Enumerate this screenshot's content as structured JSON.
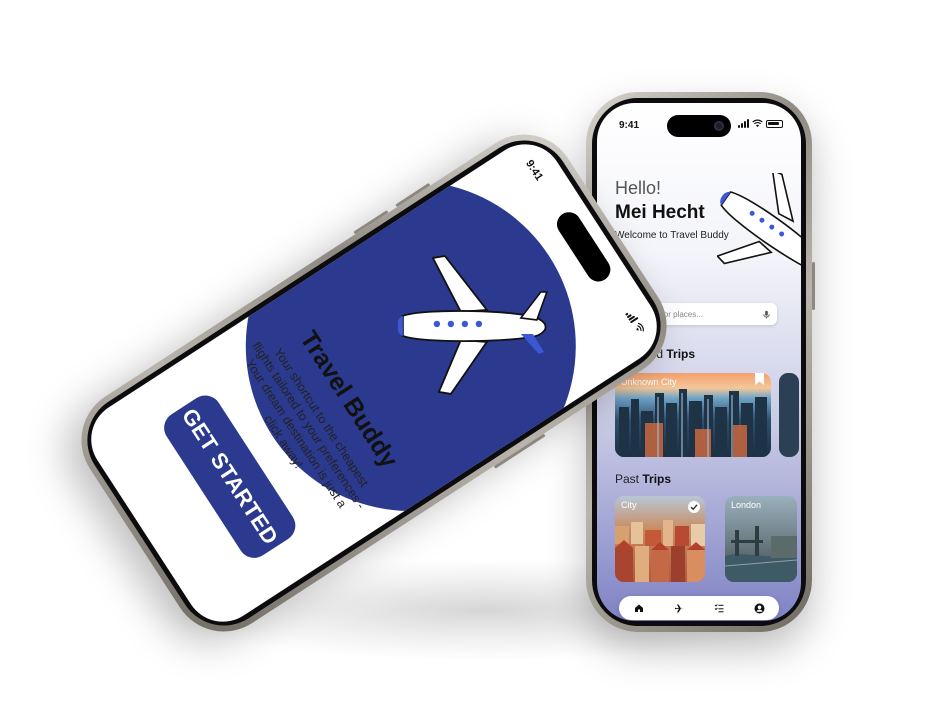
{
  "right_phone": {
    "status_time": "9:41",
    "hello": "Hello!",
    "name": "Mei Hecht",
    "welcome": "Welcome to Travel Buddy",
    "search_placeholder": "Search for places...",
    "featured_prefix": "Featured ",
    "featured_bold": "Trips",
    "featured_card_label": "Unknown City",
    "past_prefix": "Past ",
    "past_bold": "Trips",
    "past_cards": [
      {
        "label": "City"
      },
      {
        "label": "London"
      }
    ],
    "tabs": [
      "home-icon",
      "plane-icon",
      "list-icon",
      "profile-icon"
    ]
  },
  "left_phone": {
    "status_time": "9:41",
    "title": "Travel Buddy",
    "description": "Your shortcut to the cheapest flights tailored to your preferences - Your dream destination is just a click away!",
    "cta": "GET STARTED"
  },
  "colors": {
    "brand": "#2b3a8f",
    "accent_blue": "#3d58d6"
  }
}
